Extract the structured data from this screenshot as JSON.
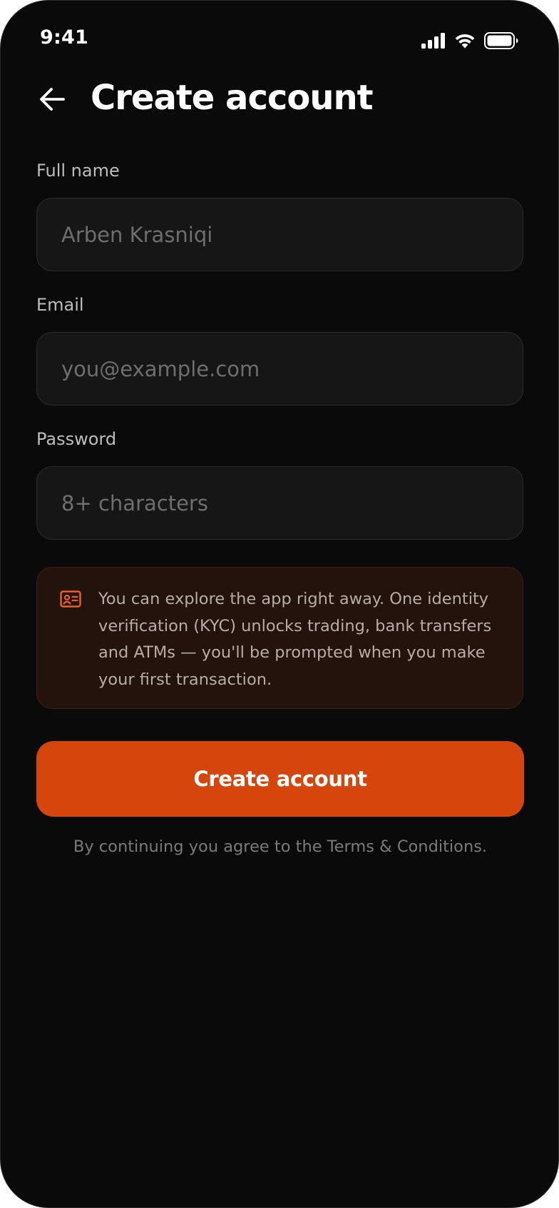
{
  "status_bar": {
    "time": "9:41",
    "icons": [
      "cellular-signal-icon",
      "wifi-icon",
      "battery-icon"
    ]
  },
  "header": {
    "back_icon": "arrow-left-icon",
    "title": "Create account"
  },
  "form": {
    "full_name": {
      "label": "Full name",
      "value": "",
      "placeholder": "Arben Krasniqi"
    },
    "email": {
      "label": "Email",
      "value": "",
      "placeholder": "you@example.com"
    },
    "password": {
      "label": "Password",
      "value": "",
      "placeholder": "8+ characters"
    }
  },
  "info": {
    "icon": "id-card-icon",
    "text": "You can explore the app right away. One identity verification (KYC) unlocks trading, bank transfers and ATMs — you'll be prompted when you make your first transaction."
  },
  "primary_button": {
    "label": "Create account"
  },
  "footer": {
    "terms": "By continuing you agree to the Terms & Conditions."
  },
  "colors": {
    "background": "#0a0a0a",
    "accent": "#d5460c",
    "field_background": "#161616",
    "info_background": "#24130d",
    "info_icon": "#e8612a"
  }
}
